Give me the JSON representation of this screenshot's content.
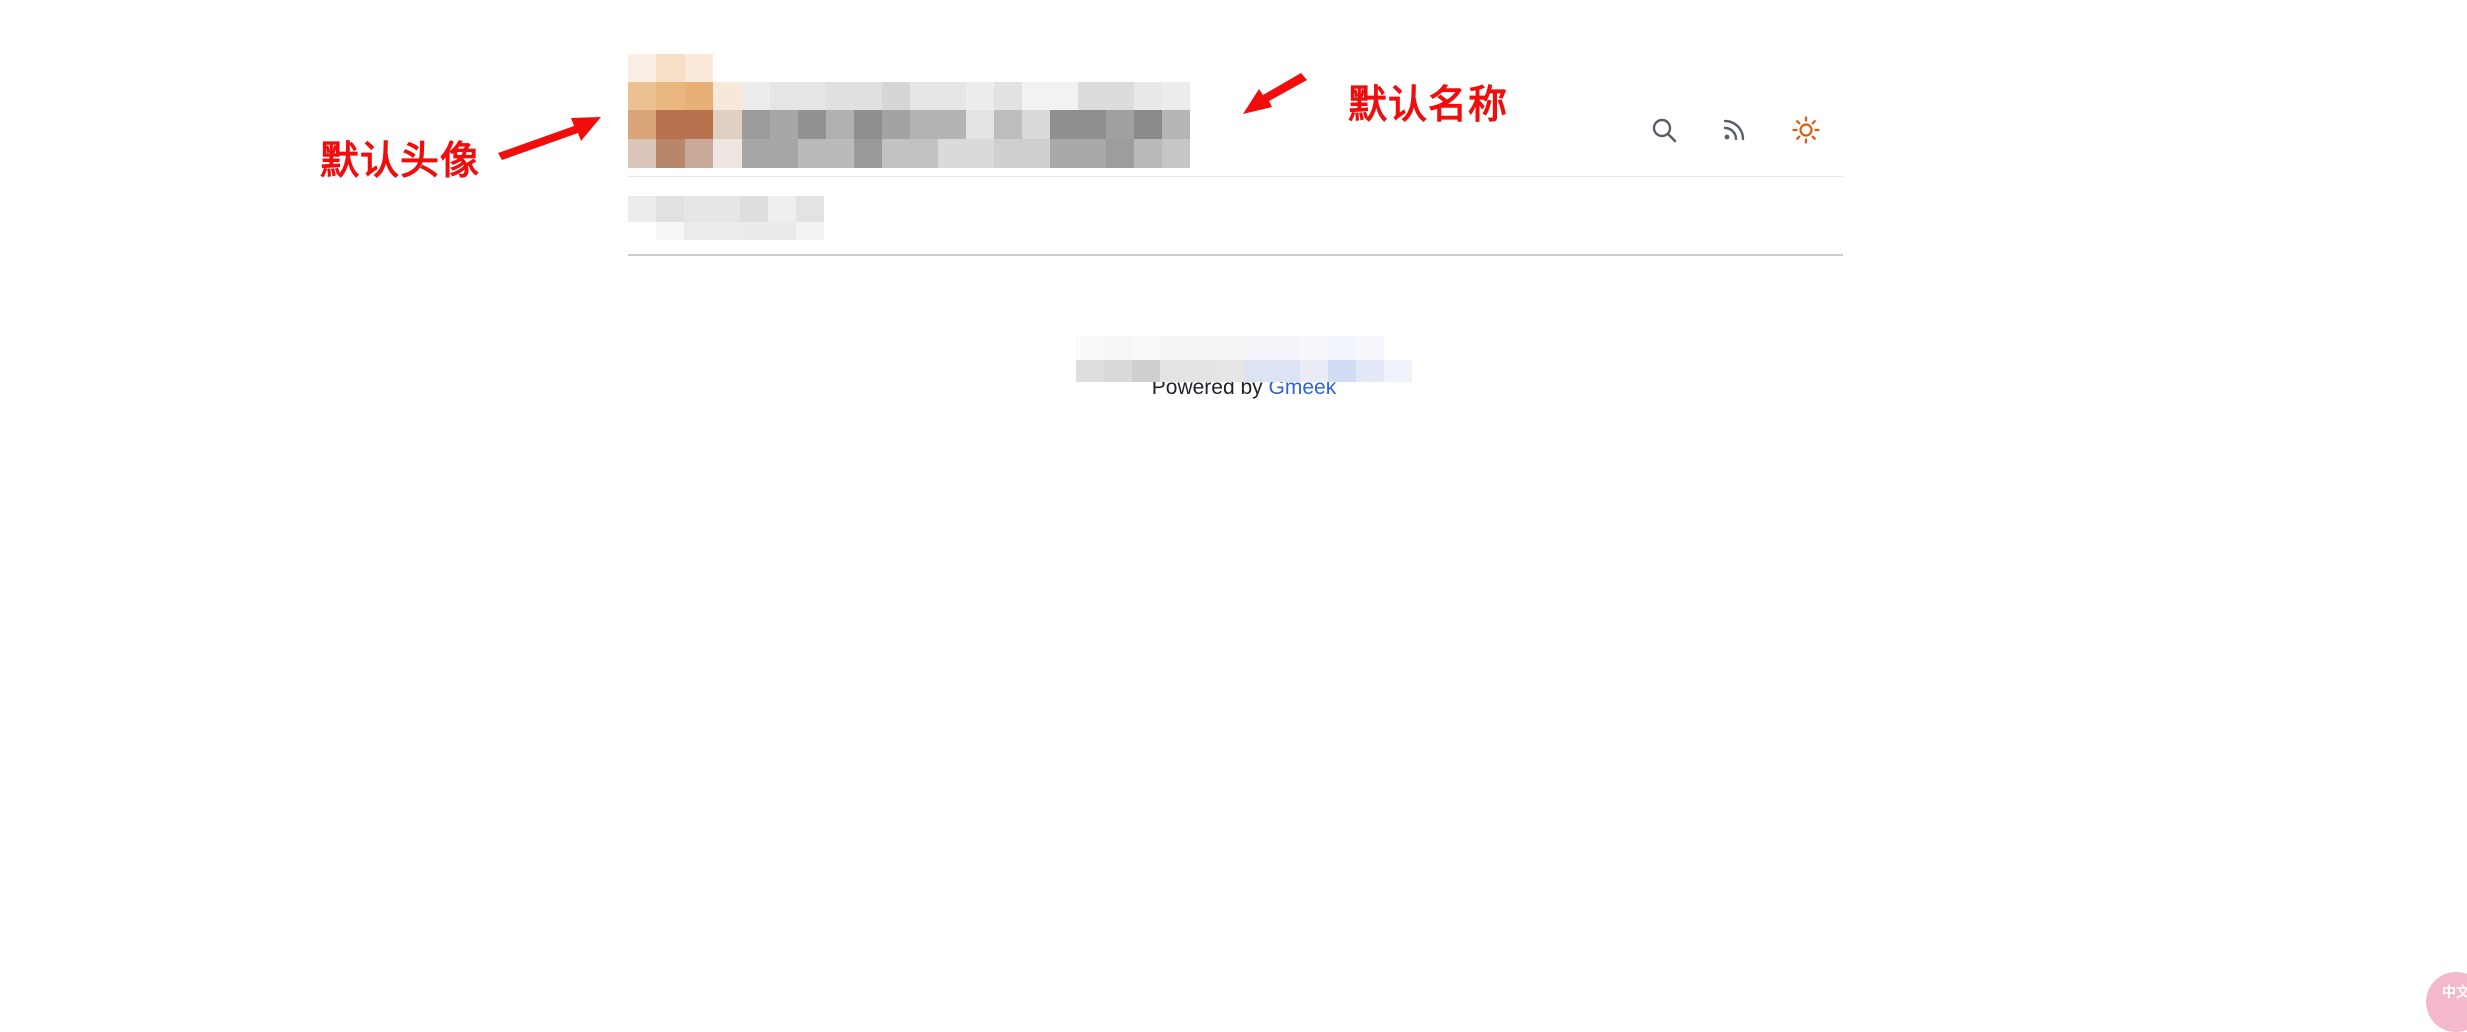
{
  "header": {
    "avatar_alt": "",
    "site_title": "",
    "icons": [
      {
        "name": "search-icon",
        "label": "Search"
      },
      {
        "name": "rss-icon",
        "label": "RSS"
      },
      {
        "name": "sun-icon",
        "label": "Theme"
      }
    ],
    "accent_color": "#e8590c"
  },
  "annotations": {
    "avatar_label": "默认头像",
    "name_label": "默认名称",
    "color": "#f20d0d"
  },
  "footer": {
    "powered_prefix": "Powered by ",
    "powered_link": "Gmeek",
    "link_color": "#2f63d6"
  },
  "corner_widget": {
    "text": "中文"
  }
}
